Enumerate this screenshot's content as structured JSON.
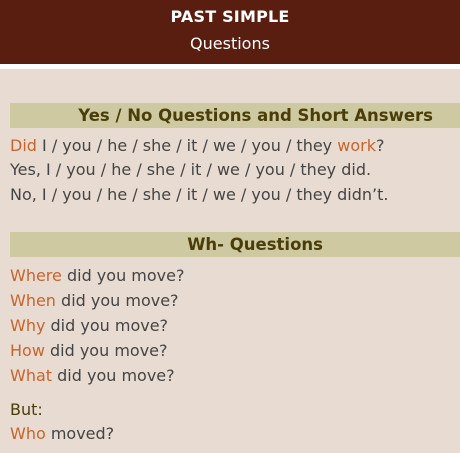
{
  "header": {
    "title": "PAST SIMPLE",
    "subtitle": "Questions"
  },
  "yes_no": {
    "heading": "Yes / No Questions and Short Answers",
    "q_aux": "Did",
    "q_middle": " I / you / he / she / it / we / you / they ",
    "q_verb": "work",
    "q_end": "?",
    "answer_yes": "Yes, I / you / he / she / it / we / you / they did.",
    "answer_no": "No, I / you / he / she / it / we / you / they didn’t."
  },
  "wh": {
    "heading": "Wh- Questions",
    "items": [
      {
        "word": "Where",
        "rest": " did you move?"
      },
      {
        "word": "When",
        "rest": " did you move?"
      },
      {
        "word": "Why",
        "rest": " did you move?"
      },
      {
        "word": "How",
        "rest": " did you move?"
      },
      {
        "word": "What",
        "rest": " did you move?"
      }
    ],
    "but_label": "But:",
    "subject_q": {
      "word": "Who",
      "rest": " moved?"
    }
  },
  "colors": {
    "header_bg": "#5a1e10",
    "content_bg": "#e8dcd2",
    "section_bar_bg": "#cfc9a2",
    "section_text": "#4a3d09",
    "highlight": "#c8642b",
    "body_text": "#444444"
  }
}
